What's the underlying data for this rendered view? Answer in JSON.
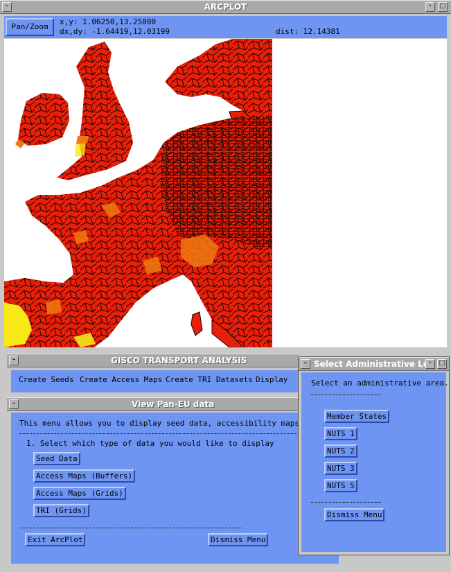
{
  "arcplot": {
    "title": "ARCPLOT",
    "pan_zoom_label": "Pan/Zoom",
    "xy_readout": "x,y: 1.06250,13.25000",
    "dxdy_readout": "dx,dy: -1.64419,12.03199",
    "dist_readout": "dist: 12.14381"
  },
  "gisco": {
    "title": "GISCO TRANSPORT ANALYSIS",
    "menu": [
      "Create Seeds",
      "Create Access Maps",
      "Create TRI Datasets",
      "Display"
    ]
  },
  "view_panel": {
    "title": "View Pan-EU data",
    "intro": "This menu allows you to display seed data, accessibility maps and TRI",
    "step1": "1. Select which type of data you would like to display",
    "buttons": [
      "Seed Data",
      "Access Maps (Buffers)",
      "Access Maps (Grids)",
      "TRI (Grids)"
    ],
    "exit_label": "Exit ArcPlot",
    "dismiss_label": "Dismiss Menu"
  },
  "admin_panel": {
    "title": "Select Administrative Lev",
    "prompt": "Select an administrative area.",
    "buttons": [
      "Member States",
      "NUTS 1",
      "NUTS 2",
      "NUTS 3",
      "NUTS 5"
    ],
    "dismiss_label": "Dismiss Menu"
  },
  "colors": {
    "panel_blue": "#6f95f3",
    "map_red": "#e8200a",
    "map_orange": "#f07a10",
    "map_yellow": "#f8e818",
    "title_grey": "#a9a9a9"
  }
}
